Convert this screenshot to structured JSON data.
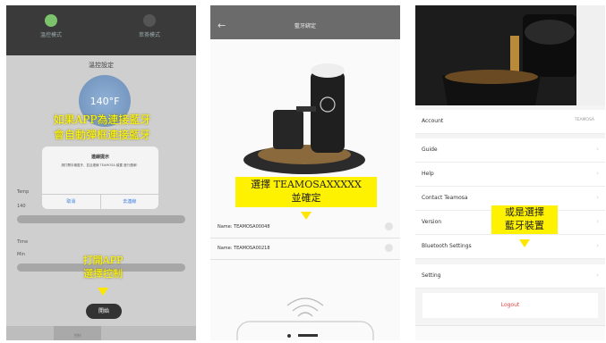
{
  "panel1": {
    "modes": [
      "溫控模式",
      "萃茶模式"
    ],
    "title": "溫控設定",
    "temperature": "140°F",
    "dialog": {
      "title": "連線提示",
      "message": "請打開手機藍牙，並且連線 TEAMOSA 裝置 進行連線！",
      "cancel": "取消",
      "confirm": "去連線"
    },
    "labels": [
      "Temp",
      "140",
      "Time",
      "Min"
    ],
    "start_button": "開始",
    "tabs": [
      "",
      "控制",
      "",
      ""
    ],
    "annotation_top": [
      "如果APP為連接藍牙",
      "會自動彈框連接藍牙"
    ],
    "annotation_bottom": [
      "打開APP",
      "選擇控制"
    ]
  },
  "panel2": {
    "back": "←",
    "title": "藍牙綁定",
    "devices": [
      "Name: TEAMOSA00048",
      "Name: TEAMOSA00218"
    ],
    "annotation": [
      "選擇 TEAMOSAXXXXX",
      "並確定"
    ]
  },
  "panel3": {
    "rows": [
      {
        "label": "Account",
        "value": "TEAMOSA"
      },
      {
        "label": "Guide",
        "value": ""
      },
      {
        "label": "Help",
        "value": ""
      },
      {
        "label": "Contact Teamosa",
        "value": ""
      },
      {
        "label": "Version",
        "value": ""
      },
      {
        "label": "Bluetooth Settings",
        "value": ""
      },
      {
        "label": "Setting",
        "value": ""
      }
    ],
    "logout": "Logout",
    "annotation": [
      "或是選擇",
      "藍牙裝置"
    ]
  },
  "colors": {
    "annotation": "#fff200",
    "dark": "#333333",
    "accent": "#3b7de0"
  }
}
